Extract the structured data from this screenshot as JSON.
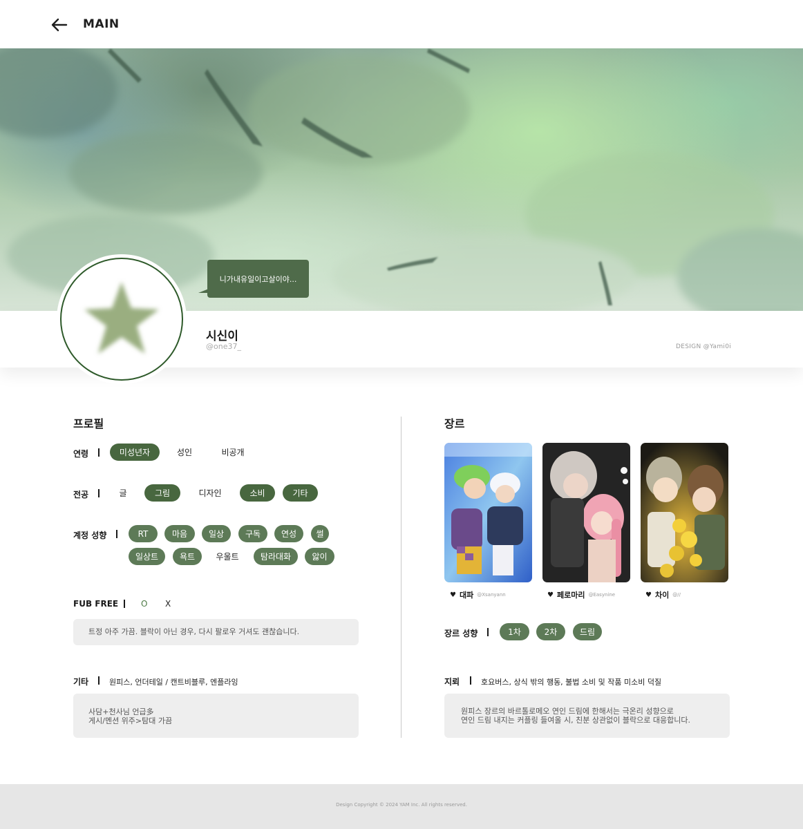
{
  "header": {
    "title": "MAIN"
  },
  "profile": {
    "status": "니가내유일이고살이야...",
    "name": "시신이",
    "handle": "@one37_",
    "design_credit": "DESIGN @Yami0i"
  },
  "left": {
    "title": "프로필",
    "age": {
      "label": "연령",
      "options": [
        "미성년자",
        "성인",
        "비공개"
      ]
    },
    "major": {
      "label": "전공",
      "options": [
        "글",
        "그림",
        "디자인",
        "소비",
        "기타"
      ]
    },
    "account": {
      "label": "계정 성향",
      "options": [
        "RT",
        "마음",
        "일상",
        "구독",
        "연성",
        "썰",
        "일상트",
        "욕트",
        "우울트",
        "탐라대화",
        "앓이"
      ]
    },
    "fub": {
      "label": "FUB FREE",
      "o": "O",
      "x": "X",
      "note": "트정 아주 가끔. 블락이 아닌 경우, 다시 팔로우 거셔도 괜찮습니다."
    },
    "etc": {
      "label": "기타",
      "value": "원피스, 언더테일 / 캔트비블루, 엔플라잉",
      "note_line1": "사담+천사님 언급多",
      "note_line2": "게시/멘션 위주>탐대 가끔"
    }
  },
  "right": {
    "title": "장르",
    "cards": [
      {
        "name": "대파",
        "source": "@Xsanyann"
      },
      {
        "name": "페로마리",
        "source": "@Easynine"
      },
      {
        "name": "차이",
        "source": "@//"
      }
    ],
    "genre_tendency": {
      "label": "장르 성향",
      "options": [
        "1차",
        "2차",
        "드림"
      ]
    },
    "mine": {
      "label": "지뢰",
      "value": "호요버스, 상식 밖의 행동, 불법 소비 및 작품 미소비 덕질",
      "note_line1": "원피스 장르의 바르톨로메오 연인 드림에 한해서는 극온리 성향으로",
      "note_line2": "연인 드림 내지는 커플링 들여올 시, 친분 상관없이 블락으로 대응합니다."
    }
  },
  "footer": {
    "text": "Design Copyright © 2024 YAM Inc. All rights reserved."
  },
  "colors": {
    "accent": "#5d7a57",
    "accent_dark": "#48673f",
    "ring": "#2e5a2a",
    "star": "#9aae80"
  }
}
